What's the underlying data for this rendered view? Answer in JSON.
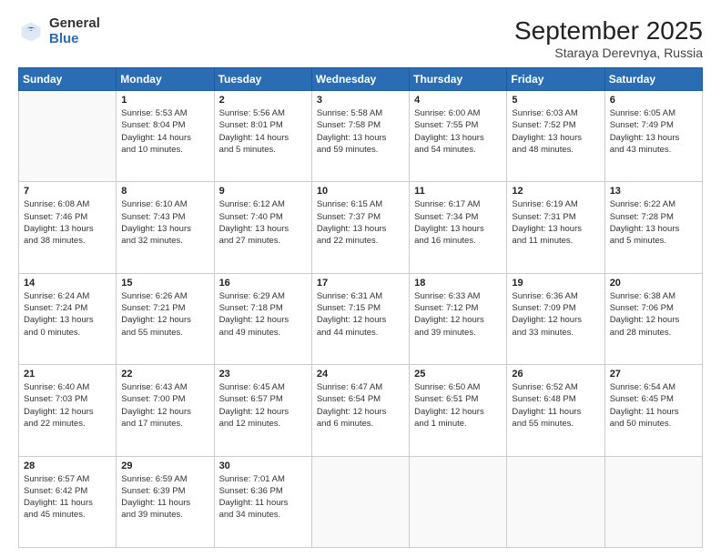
{
  "logo": {
    "general": "General",
    "blue": "Blue"
  },
  "title": "September 2025",
  "location": "Staraya Derevnya, Russia",
  "days_of_week": [
    "Sunday",
    "Monday",
    "Tuesday",
    "Wednesday",
    "Thursday",
    "Friday",
    "Saturday"
  ],
  "weeks": [
    [
      {
        "day": "",
        "info": ""
      },
      {
        "day": "1",
        "info": "Sunrise: 5:53 AM\nSunset: 8:04 PM\nDaylight: 14 hours\nand 10 minutes."
      },
      {
        "day": "2",
        "info": "Sunrise: 5:56 AM\nSunset: 8:01 PM\nDaylight: 14 hours\nand 5 minutes."
      },
      {
        "day": "3",
        "info": "Sunrise: 5:58 AM\nSunset: 7:58 PM\nDaylight: 13 hours\nand 59 minutes."
      },
      {
        "day": "4",
        "info": "Sunrise: 6:00 AM\nSunset: 7:55 PM\nDaylight: 13 hours\nand 54 minutes."
      },
      {
        "day": "5",
        "info": "Sunrise: 6:03 AM\nSunset: 7:52 PM\nDaylight: 13 hours\nand 48 minutes."
      },
      {
        "day": "6",
        "info": "Sunrise: 6:05 AM\nSunset: 7:49 PM\nDaylight: 13 hours\nand 43 minutes."
      }
    ],
    [
      {
        "day": "7",
        "info": "Sunrise: 6:08 AM\nSunset: 7:46 PM\nDaylight: 13 hours\nand 38 minutes."
      },
      {
        "day": "8",
        "info": "Sunrise: 6:10 AM\nSunset: 7:43 PM\nDaylight: 13 hours\nand 32 minutes."
      },
      {
        "day": "9",
        "info": "Sunrise: 6:12 AM\nSunset: 7:40 PM\nDaylight: 13 hours\nand 27 minutes."
      },
      {
        "day": "10",
        "info": "Sunrise: 6:15 AM\nSunset: 7:37 PM\nDaylight: 13 hours\nand 22 minutes."
      },
      {
        "day": "11",
        "info": "Sunrise: 6:17 AM\nSunset: 7:34 PM\nDaylight: 13 hours\nand 16 minutes."
      },
      {
        "day": "12",
        "info": "Sunrise: 6:19 AM\nSunset: 7:31 PM\nDaylight: 13 hours\nand 11 minutes."
      },
      {
        "day": "13",
        "info": "Sunrise: 6:22 AM\nSunset: 7:28 PM\nDaylight: 13 hours\nand 5 minutes."
      }
    ],
    [
      {
        "day": "14",
        "info": "Sunrise: 6:24 AM\nSunset: 7:24 PM\nDaylight: 13 hours\nand 0 minutes."
      },
      {
        "day": "15",
        "info": "Sunrise: 6:26 AM\nSunset: 7:21 PM\nDaylight: 12 hours\nand 55 minutes."
      },
      {
        "day": "16",
        "info": "Sunrise: 6:29 AM\nSunset: 7:18 PM\nDaylight: 12 hours\nand 49 minutes."
      },
      {
        "day": "17",
        "info": "Sunrise: 6:31 AM\nSunset: 7:15 PM\nDaylight: 12 hours\nand 44 minutes."
      },
      {
        "day": "18",
        "info": "Sunrise: 6:33 AM\nSunset: 7:12 PM\nDaylight: 12 hours\nand 39 minutes."
      },
      {
        "day": "19",
        "info": "Sunrise: 6:36 AM\nSunset: 7:09 PM\nDaylight: 12 hours\nand 33 minutes."
      },
      {
        "day": "20",
        "info": "Sunrise: 6:38 AM\nSunset: 7:06 PM\nDaylight: 12 hours\nand 28 minutes."
      }
    ],
    [
      {
        "day": "21",
        "info": "Sunrise: 6:40 AM\nSunset: 7:03 PM\nDaylight: 12 hours\nand 22 minutes."
      },
      {
        "day": "22",
        "info": "Sunrise: 6:43 AM\nSunset: 7:00 PM\nDaylight: 12 hours\nand 17 minutes."
      },
      {
        "day": "23",
        "info": "Sunrise: 6:45 AM\nSunset: 6:57 PM\nDaylight: 12 hours\nand 12 minutes."
      },
      {
        "day": "24",
        "info": "Sunrise: 6:47 AM\nSunset: 6:54 PM\nDaylight: 12 hours\nand 6 minutes."
      },
      {
        "day": "25",
        "info": "Sunrise: 6:50 AM\nSunset: 6:51 PM\nDaylight: 12 hours\nand 1 minute."
      },
      {
        "day": "26",
        "info": "Sunrise: 6:52 AM\nSunset: 6:48 PM\nDaylight: 11 hours\nand 55 minutes."
      },
      {
        "day": "27",
        "info": "Sunrise: 6:54 AM\nSunset: 6:45 PM\nDaylight: 11 hours\nand 50 minutes."
      }
    ],
    [
      {
        "day": "28",
        "info": "Sunrise: 6:57 AM\nSunset: 6:42 PM\nDaylight: 11 hours\nand 45 minutes."
      },
      {
        "day": "29",
        "info": "Sunrise: 6:59 AM\nSunset: 6:39 PM\nDaylight: 11 hours\nand 39 minutes."
      },
      {
        "day": "30",
        "info": "Sunrise: 7:01 AM\nSunset: 6:36 PM\nDaylight: 11 hours\nand 34 minutes."
      },
      {
        "day": "",
        "info": ""
      },
      {
        "day": "",
        "info": ""
      },
      {
        "day": "",
        "info": ""
      },
      {
        "day": "",
        "info": ""
      }
    ]
  ]
}
